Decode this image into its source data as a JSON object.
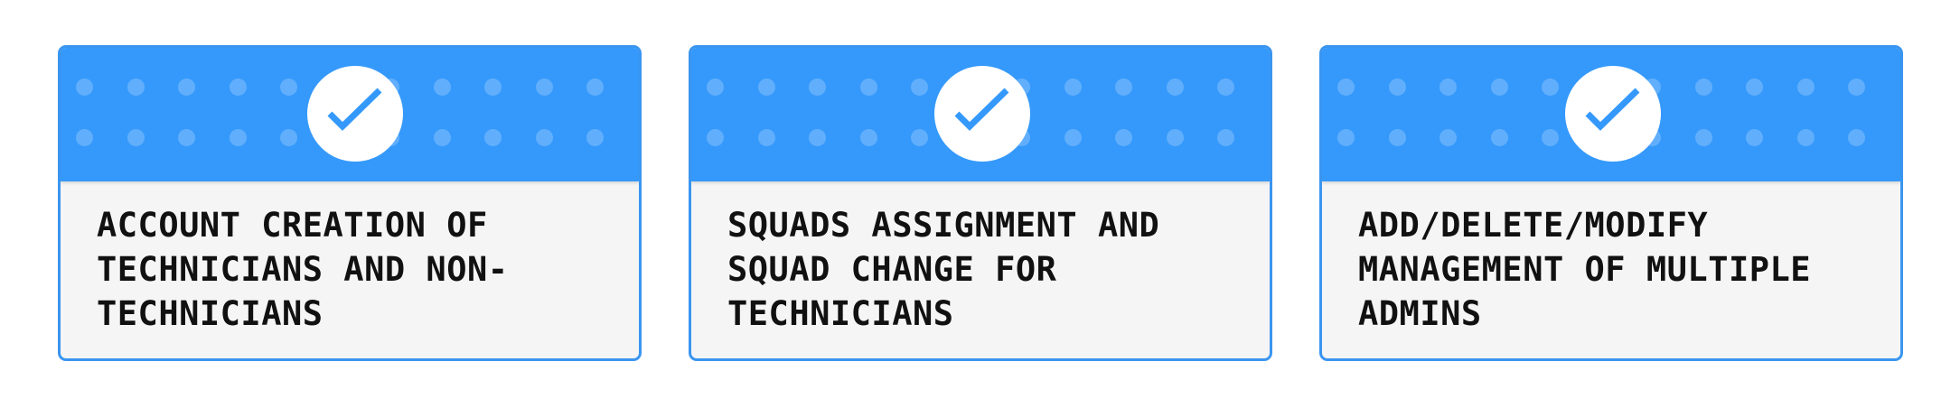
{
  "cards": [
    {
      "text": "ACCOUNT CREATION OF\nTECHNICIANS AND NON-\nTECHNICIANS",
      "icon": "checkmark-icon"
    },
    {
      "text": "SQUADS ASSIGNMENT AND\nSQUAD CHANGE FOR\nTECHNICIANS",
      "icon": "checkmark-icon"
    },
    {
      "text": "ADD/DELETE/MODIFY\nMANAGEMENT OF MULTIPLE\nADMINS",
      "icon": "checkmark-icon"
    }
  ],
  "colors": {
    "header": "#3599fb",
    "border": "#3a95f0",
    "body": "#f5f5f5",
    "check": "#3599fb"
  }
}
